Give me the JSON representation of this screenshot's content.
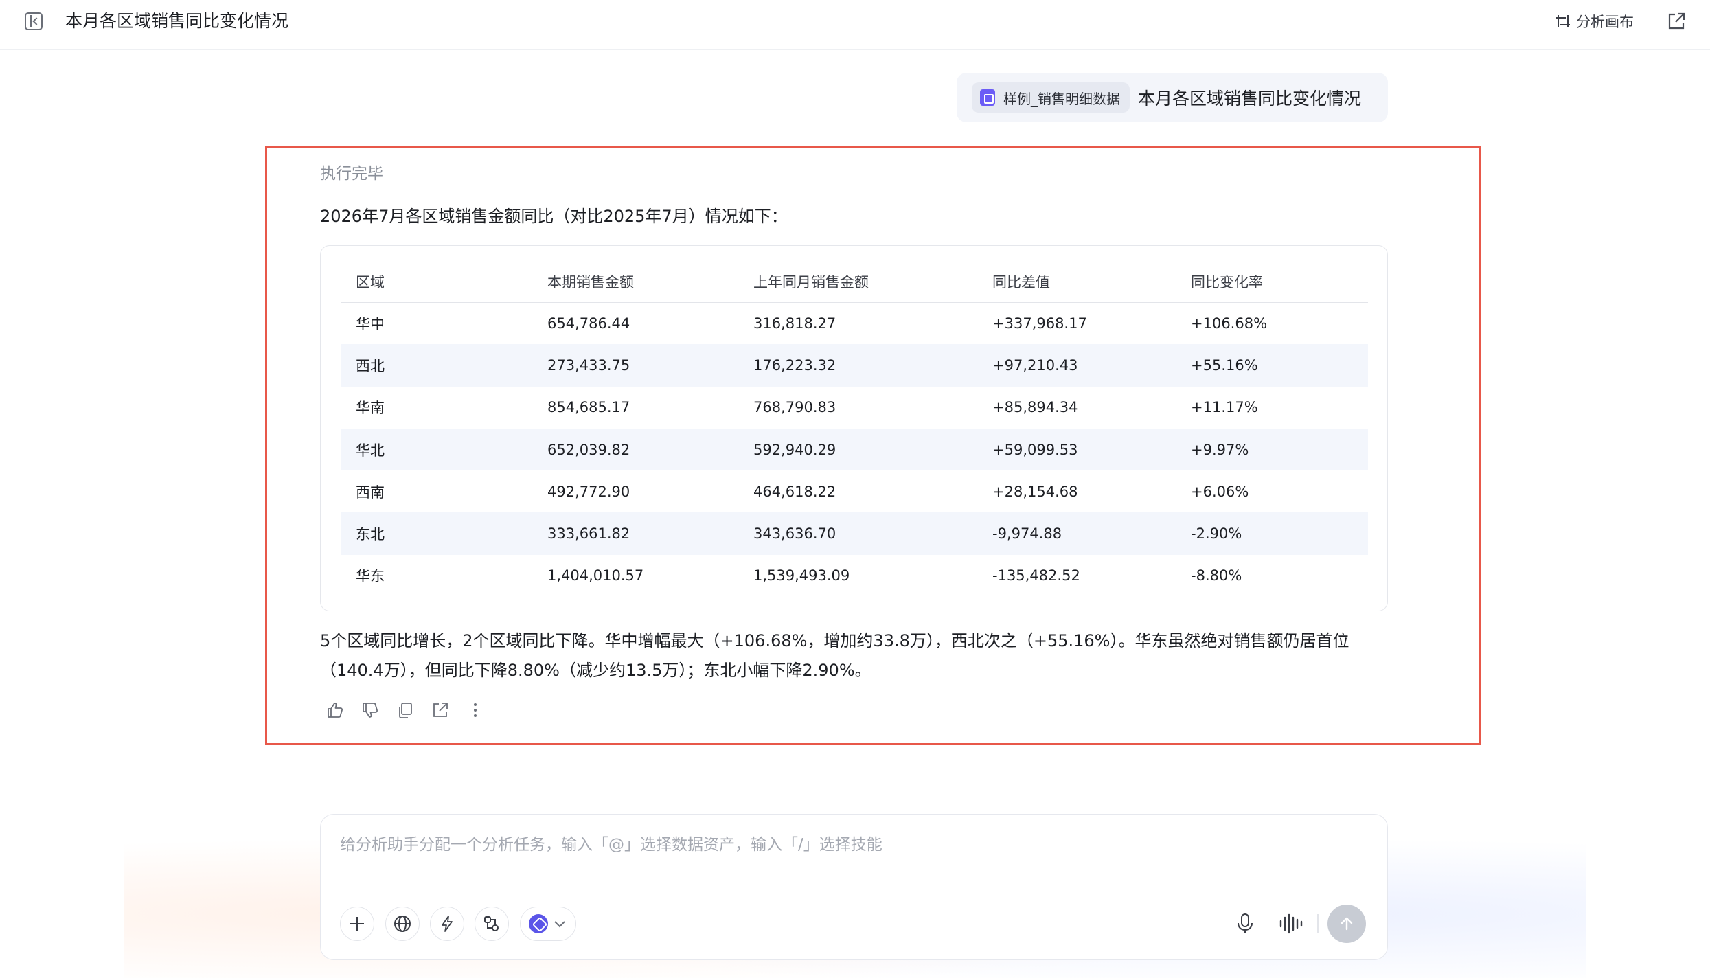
{
  "header": {
    "title": "本月各区域销售同比变化情况",
    "canvas_label": "分析画布"
  },
  "user_message": {
    "asset_label": "样例_销售明细数据",
    "text": "本月各区域销售同比变化情况"
  },
  "response": {
    "status": "执行完毕",
    "intro": "2026年7月各区域销售金额同比（对比2025年7月）情况如下：",
    "table": {
      "columns": [
        "区域",
        "本期销售金额",
        "上年同月销售金额",
        "同比差值",
        "同比变化率"
      ],
      "rows": [
        [
          "华中",
          "654,786.44",
          "316,818.27",
          "+337,968.17",
          "+106.68%"
        ],
        [
          "西北",
          "273,433.75",
          "176,223.32",
          "+97,210.43",
          "+55.16%"
        ],
        [
          "华南",
          "854,685.17",
          "768,790.83",
          "+85,894.34",
          "+11.17%"
        ],
        [
          "华北",
          "652,039.82",
          "592,940.29",
          "+59,099.53",
          "+9.97%"
        ],
        [
          "西南",
          "492,772.90",
          "464,618.22",
          "+28,154.68",
          "+6.06%"
        ],
        [
          "东北",
          "333,661.82",
          "343,636.70",
          "-9,974.88",
          "-2.90%"
        ],
        [
          "华东",
          "1,404,010.57",
          "1,539,493.09",
          "-135,482.52",
          "-8.80%"
        ]
      ]
    },
    "summary": "5个区域同比增长，2个区域同比下降。华中增幅最大（+106.68%，增加约33.8万），西北次之（+55.16%）。华东虽然绝对销售额仍居首位（140.4万），但同比下降8.80%（减少约13.5万）；东北小幅下降2.90%。"
  },
  "chat_input": {
    "placeholder": "给分析助手分配一个分析任务，输入「@」选择数据资产，输入「/」选择技能"
  },
  "colors": {
    "highlight_border": "#e8584a",
    "asset_icon": "#6b5cf6",
    "model_logo": "#5b55e8",
    "row_alt": "#f3f6fc"
  },
  "icons": {
    "topbar": [
      "sidebar-toggle-icon",
      "canvas-icon",
      "share-icon"
    ],
    "actions": [
      "thumbs-up-icon",
      "thumbs-down-icon",
      "copy-icon",
      "share-icon",
      "more-icon"
    ],
    "input_tools": [
      "plus-icon",
      "globe-icon",
      "lightning-icon",
      "skill-icon",
      "model-logo-icon",
      "chevron-down-icon",
      "microphone-icon",
      "voice-wave-icon",
      "send-arrow-icon"
    ]
  }
}
